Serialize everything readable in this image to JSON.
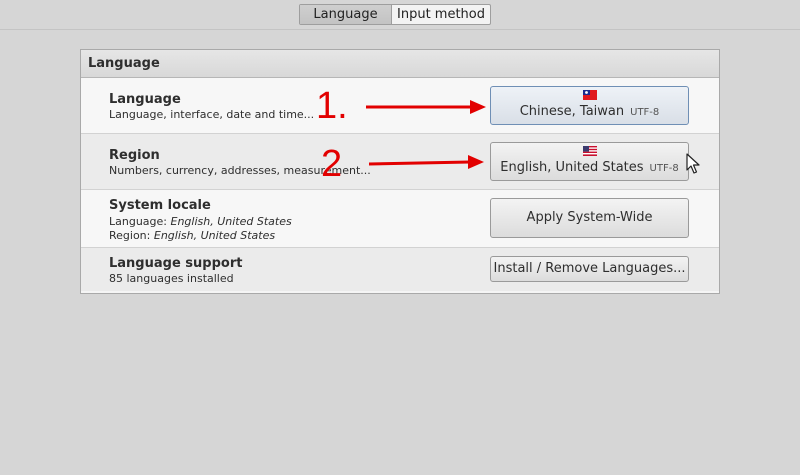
{
  "tabs": [
    {
      "label": "Language",
      "active": true
    },
    {
      "label": "Input method",
      "active": false
    }
  ],
  "panel": {
    "title": "Language",
    "rows": [
      {
        "title": "Language",
        "subtitle": "Language, interface, date and time...",
        "button": {
          "label": "Chinese, Taiwan",
          "encoding": "UTF-8",
          "flag": "taiwan-flag-icon"
        }
      },
      {
        "title": "Region",
        "subtitle": "Numbers, currency, addresses, measurement...",
        "button": {
          "label": "English, United States",
          "encoding": "UTF-8",
          "flag": "us-flag-icon"
        }
      },
      {
        "title": "System locale",
        "language_label": "Language:",
        "language_value": "English, United States",
        "region_label": "Region:",
        "region_value": "English, United States",
        "button": {
          "label": "Apply System-Wide"
        }
      },
      {
        "title": "Language support",
        "subtitle": "85 languages installed",
        "button": {
          "label": "Install / Remove Languages..."
        }
      }
    ]
  },
  "annotations": [
    {
      "label": "1."
    },
    {
      "label": "2"
    }
  ],
  "colors": {
    "annotation": "#e20000",
    "background": "#d6d6d6",
    "panel_header": "#dcdcdc"
  }
}
